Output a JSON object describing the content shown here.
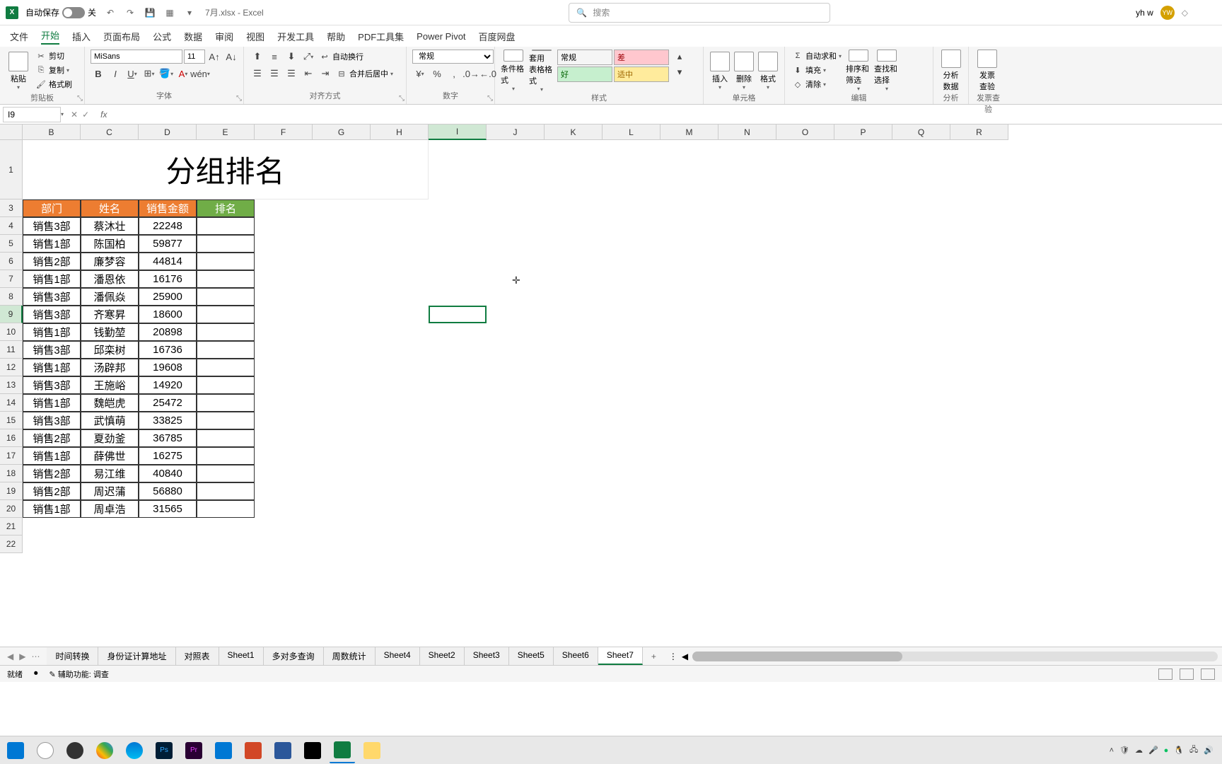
{
  "titlebar": {
    "autosave_label": "自动保存",
    "autosave_state": "关",
    "filename": "7月.xlsx - Excel",
    "search_placeholder": "搜索",
    "user_name": "yh w",
    "user_initials": "YW"
  },
  "tabs": [
    "文件",
    "开始",
    "插入",
    "页面布局",
    "公式",
    "数据",
    "审阅",
    "视图",
    "开发工具",
    "帮助",
    "PDF工具集",
    "Power Pivot",
    "百度网盘"
  ],
  "active_tab": "开始",
  "ribbon": {
    "clipboard": {
      "paste": "粘贴",
      "cut": "剪切",
      "copy": "复制",
      "painter": "格式刷",
      "label": "剪贴板"
    },
    "font": {
      "name": "MiSans",
      "size": "11",
      "label": "字体"
    },
    "align": {
      "wrap": "自动换行",
      "merge": "合并后居中",
      "label": "对齐方式"
    },
    "number": {
      "format": "常规",
      "label": "数字"
    },
    "styles": {
      "cond": "条件格式",
      "table": "套用\n表格格式",
      "normal": "常规",
      "bad": "差",
      "good": "好",
      "neutral": "适中",
      "label": "样式"
    },
    "cells": {
      "insert": "插入",
      "delete": "删除",
      "format": "格式",
      "label": "单元格"
    },
    "editing": {
      "sum": "自动求和",
      "fill": "填充",
      "clear": "清除",
      "sort": "排序和筛选",
      "find": "查找和选择",
      "label": "编辑"
    },
    "analysis": {
      "analyze": "分析\n数据",
      "label": "分析"
    },
    "invoice": {
      "check": "发票\n查验",
      "label": "发票查验"
    }
  },
  "formula_bar": {
    "cell_ref": "I9",
    "formula": ""
  },
  "columns": [
    "B",
    "C",
    "D",
    "E",
    "F",
    "G",
    "H",
    "I",
    "J",
    "K",
    "L",
    "M",
    "N",
    "O",
    "P",
    "Q",
    "R"
  ],
  "row_numbers": [
    1,
    3,
    4,
    5,
    6,
    7,
    8,
    9,
    10,
    11,
    12,
    13,
    14,
    15,
    16,
    17,
    18,
    19,
    20,
    21,
    22
  ],
  "selected_cell": "I9",
  "chart_data": {
    "type": "table",
    "title": "分组排名",
    "columns": [
      "部门",
      "姓名",
      "销售金额",
      "排名"
    ],
    "rows": [
      {
        "dept": "销售3部",
        "name": "蔡沐壮",
        "amount": 22248,
        "rank": ""
      },
      {
        "dept": "销售1部",
        "name": "陈国柏",
        "amount": 59877,
        "rank": ""
      },
      {
        "dept": "销售2部",
        "name": "廉梦容",
        "amount": 44814,
        "rank": ""
      },
      {
        "dept": "销售1部",
        "name": "潘恩依",
        "amount": 16176,
        "rank": ""
      },
      {
        "dept": "销售3部",
        "name": "潘佩焱",
        "amount": 25900,
        "rank": ""
      },
      {
        "dept": "销售3部",
        "name": "齐寒昇",
        "amount": 18600,
        "rank": ""
      },
      {
        "dept": "销售1部",
        "name": "钱勤堃",
        "amount": 20898,
        "rank": ""
      },
      {
        "dept": "销售3部",
        "name": "邱栾树",
        "amount": 16736,
        "rank": ""
      },
      {
        "dept": "销售1部",
        "name": "汤辟邦",
        "amount": 19608,
        "rank": ""
      },
      {
        "dept": "销售3部",
        "name": "王施峪",
        "amount": 14920,
        "rank": ""
      },
      {
        "dept": "销售1部",
        "name": "魏皑虎",
        "amount": 25472,
        "rank": ""
      },
      {
        "dept": "销售3部",
        "name": "武慎萌",
        "amount": 33825,
        "rank": ""
      },
      {
        "dept": "销售2部",
        "name": "夏劲釜",
        "amount": 36785,
        "rank": ""
      },
      {
        "dept": "销售1部",
        "name": "薛佛世",
        "amount": 16275,
        "rank": ""
      },
      {
        "dept": "销售2部",
        "name": "易江维",
        "amount": 40840,
        "rank": ""
      },
      {
        "dept": "销售2部",
        "name": "周迟蒲",
        "amount": 56880,
        "rank": ""
      },
      {
        "dept": "销售1部",
        "name": "周卓浩",
        "amount": 31565,
        "rank": ""
      }
    ]
  },
  "sheet_tabs": [
    "时间转换",
    "身份证计算地址",
    "对照表",
    "Sheet1",
    "多对多查询",
    "周数统计",
    "Sheet4",
    "Sheet2",
    "Sheet3",
    "Sheet5",
    "Sheet6",
    "Sheet7"
  ],
  "active_sheet": "Sheet7",
  "status": {
    "ready": "就绪",
    "access": "辅助功能: 调查"
  }
}
